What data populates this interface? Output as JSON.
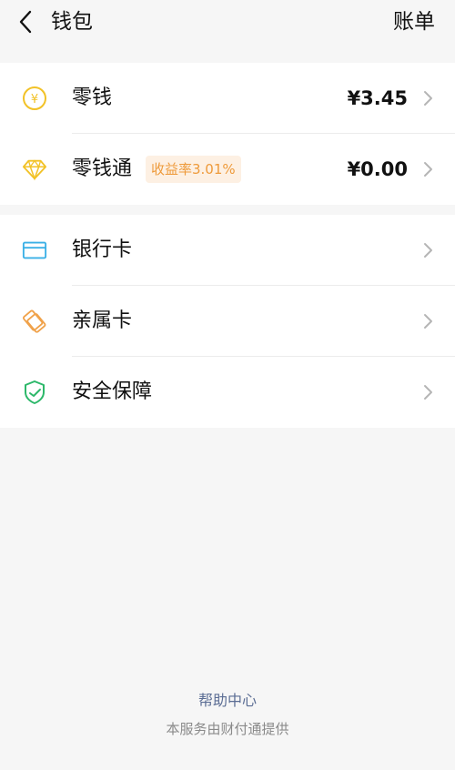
{
  "header": {
    "title": "钱包",
    "bill_label": "账单",
    "back_icon": "chevron-left-icon"
  },
  "balance_group": {
    "items": [
      {
        "label": "零钱",
        "value": "¥3.45",
        "icon": "yuan-coin-icon",
        "icon_color": "#f2c227"
      },
      {
        "label": "零钱通",
        "badge": "收益率3.01%",
        "value": "¥0.00",
        "icon": "diamond-icon",
        "icon_color": "#f2c227"
      }
    ]
  },
  "services_group": {
    "items": [
      {
        "label": "银行卡",
        "icon": "bank-card-icon",
        "icon_color": "#3bb0e6"
      },
      {
        "label": "亲属卡",
        "icon": "family-card-icon",
        "icon_color": "#f0a24a"
      },
      {
        "label": "安全保障",
        "icon": "shield-check-icon",
        "icon_color": "#2db86a"
      }
    ]
  },
  "footer": {
    "help_link": "帮助中心",
    "provider_note": "本服务由财付通提供"
  },
  "colors": {
    "background": "#f6f6f6",
    "badge_bg": "#fdf0e3",
    "badge_text": "#ee9a3a",
    "link": "#5b6d94"
  }
}
